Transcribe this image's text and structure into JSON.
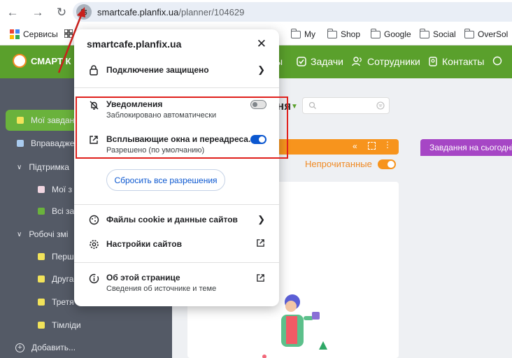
{
  "browser": {
    "url_host": "smartcafe.planfix.ua",
    "url_path": "/planner/104629"
  },
  "bookmarks": {
    "items": [
      {
        "label": "Сервисы"
      },
      {
        "label": "My"
      },
      {
        "label": "Shop"
      },
      {
        "label": "Google"
      },
      {
        "label": "Social"
      },
      {
        "label": "OverSol"
      }
    ]
  },
  "appbar": {
    "brand": "СМАРТ К",
    "items": [
      {
        "label": "ы"
      },
      {
        "label": "Задачи"
      },
      {
        "label": "Сотрудники"
      },
      {
        "label": "Контакты"
      }
    ]
  },
  "sidebar": {
    "items": [
      {
        "label": "Мої завдан",
        "color": "#f2e35a"
      },
      {
        "label": "Вправадже",
        "color": "#a9cbef"
      },
      {
        "label": "Підтримка"
      },
      {
        "label": "Мої з",
        "color": "#f1d6e1"
      },
      {
        "label": "Всі за",
        "color": "#6ab23c"
      },
      {
        "label": "Робочі змі"
      },
      {
        "label": "Перш",
        "color": "#f2e35a"
      },
      {
        "label": "Друга",
        "color": "#f2e35a"
      },
      {
        "label": "Третя",
        "color": "#f2e35a"
      },
      {
        "label": "Тімліди",
        "color": "#f2e35a"
      },
      {
        "label": "Добавить..."
      }
    ]
  },
  "content": {
    "title": "ня",
    "unread_label": "Непрочитанные",
    "purple_tab": "Завдання на сьогодні"
  },
  "popup": {
    "title": "smartcafe.planfix.ua",
    "connection": "Подключение защищено",
    "notifications": {
      "label": "Уведомления",
      "sub": "Заблокировано автоматически"
    },
    "popups": {
      "label": "Всплывающие окна и переадреса...",
      "sub": "Разрешено (по умолчанию)"
    },
    "reset_button": "Сбросить все разрешения",
    "cookies": "Файлы cookie и данные сайтов",
    "site_settings": "Настройки сайтов",
    "about": {
      "label": "Об этой странице",
      "sub": "Сведения об источнике и теме"
    }
  },
  "colors": {
    "app_green": "#5aa02c",
    "sidebar": "#545a66",
    "accent_orange": "#f7941d",
    "purple": "#a646c5",
    "toggle_on": "#0b57d0",
    "highlight": "#e0201c"
  }
}
